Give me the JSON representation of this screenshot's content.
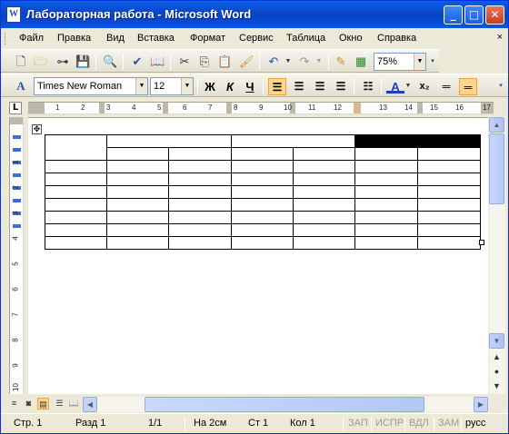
{
  "window": {
    "title": "Лабораторная работа - Microsoft Word",
    "title_icon": "W",
    "minimize_glyph": "_",
    "maximize_glyph": "□",
    "close_glyph": "✕"
  },
  "menu": {
    "items": [
      "Файл",
      "Правка",
      "Вид",
      "Вставка",
      "Формат",
      "Сервис",
      "Таблица",
      "Окно",
      "Справка"
    ],
    "close_glyph": "×"
  },
  "toolbar_standard": {
    "zoom": "75%"
  },
  "toolbar_formatting": {
    "style_glyph": "A",
    "font": "Times New Roman",
    "size": "12",
    "bold": "Ж",
    "italic": "К",
    "underline": "Ч",
    "font_color_glyph": "A"
  },
  "ruler": {
    "corner": "L",
    "h_numbers": [
      "1",
      "2",
      "3",
      "4",
      "5",
      "6",
      "7",
      "8",
      "9",
      "10",
      "11",
      "12",
      "13",
      "14",
      "15",
      "16",
      "17"
    ],
    "v_numbers": [
      "1",
      "2",
      "3",
      "4",
      "5",
      "6",
      "7",
      "8",
      "9",
      "10"
    ]
  },
  "document": {
    "move_handle_glyph": "✥",
    "table": {
      "columns": 7,
      "rows": 9,
      "merged_header_row": true,
      "selected_cell": "row 1, columns 6-7",
      "selection_color": "#000000"
    }
  },
  "status": {
    "page": "Стр. 1",
    "section": "Разд 1",
    "pages": "1/1",
    "at": "На 2см",
    "line": "Ст 1",
    "col": "Кол 1",
    "rec": "ЗАП",
    "trk": "ИСПР",
    "ext": "ВДЛ",
    "ovr": "ЗАМ",
    "lang": "русс"
  },
  "colors": {
    "titlebar": "#0a56e0",
    "selection": "#000000",
    "active_button": "#ffd590"
  }
}
